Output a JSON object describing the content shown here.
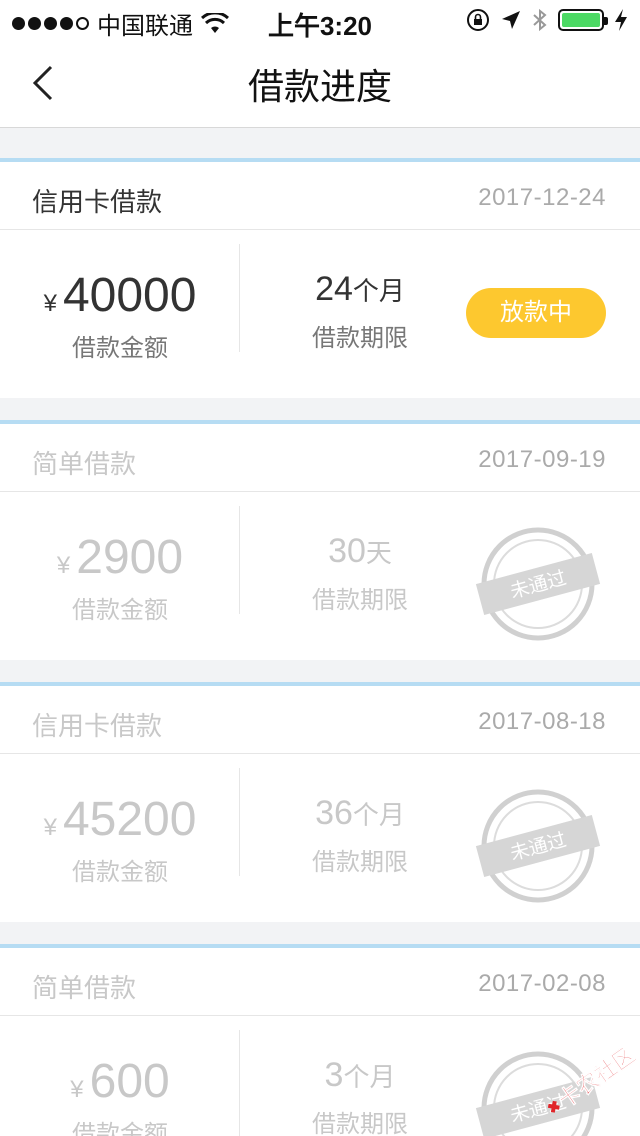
{
  "status_bar": {
    "carrier": "中国联通",
    "time": "上午3:20",
    "battery_color": "#4cd964"
  },
  "header": {
    "title": "借款进度"
  },
  "loans": [
    {
      "type": "信用卡借款",
      "date": "2017-12-24",
      "currency": "¥",
      "amount": "40000",
      "amount_label": "借款金额",
      "term_number": "24",
      "term_unit": "个月",
      "term_label": "借款期限",
      "status": "放款中"
    },
    {
      "type": "简单借款",
      "date": "2017-09-19",
      "currency": "¥",
      "amount": "2900",
      "amount_label": "借款金额",
      "term_number": "30",
      "term_unit": "天",
      "term_label": "借款期限",
      "status": "未通过"
    },
    {
      "type": "信用卡借款",
      "date": "2017-08-18",
      "currency": "¥",
      "amount": "45200",
      "amount_label": "借款金额",
      "term_number": "36",
      "term_unit": "个月",
      "term_label": "借款期限",
      "status": "未通过"
    },
    {
      "type": "简单借款",
      "date": "2017-02-08",
      "currency": "¥",
      "amount": "600",
      "amount_label": "借款金额",
      "term_number": "3",
      "term_unit": "个月",
      "term_label": "借款期限",
      "status": "未通过"
    }
  ],
  "watermark": {
    "text": "卡农社区"
  },
  "colors": {
    "accent": "#fdc82f",
    "card_border": "#b6dcf3",
    "muted_text": "#c8c8c8"
  }
}
